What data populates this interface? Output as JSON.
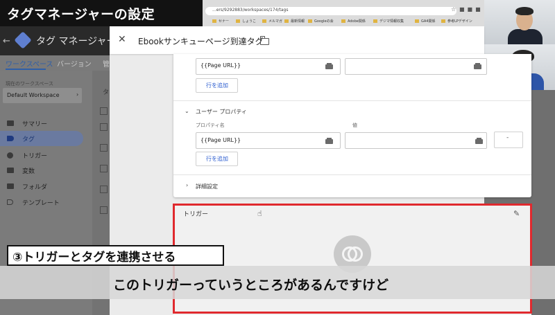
{
  "video_title": "タグマネージャーの設定",
  "browser": {
    "url": "...ers/9292883/workspaces/174/tags",
    "bookmarks": [
      "セナー",
      "しょうこ",
      "メルマガ",
      "最新情報",
      "Googleの会",
      "Adobe関係",
      "デジマ情報収集",
      "GA4関係",
      "参考LPデザイン"
    ]
  },
  "gtm": {
    "app_title": "タグ マネージャー",
    "tabs": [
      "ワークスペース",
      "バージョン",
      "管"
    ],
    "workspace_caption": "現在のワークスペース",
    "workspace_name": "Default Workspace",
    "nav": [
      {
        "label": "サマリー",
        "icon": "summary-icon"
      },
      {
        "label": "タグ",
        "icon": "tag-icon",
        "active": true
      },
      {
        "label": "トリガー",
        "icon": "trigger-icon"
      },
      {
        "label": "変数",
        "icon": "variables-icon"
      },
      {
        "label": "フォルダ",
        "icon": "folder-icon"
      },
      {
        "label": "テンプレート",
        "icon": "template-icon"
      }
    ],
    "list_header": "タ"
  },
  "editor": {
    "close_icon": "close-icon",
    "tag_name": "Ebookサンキューページ到達タグ",
    "top_field_value": "{{Page URL}}",
    "add_row_label": "行を追加",
    "user_properties": {
      "title": "ユーザー プロパティ",
      "name_col": "プロパティ名",
      "value_col": "値",
      "name_value": "{{Page URL}}",
      "value_value": "",
      "remove_label": "-"
    },
    "advanced_title": "詳細設定",
    "trigger": {
      "title": "トリガー",
      "edit_icon": "edit-pencil-icon"
    }
  },
  "overlays": {
    "step_label": "③トリガーとタグを連携させる",
    "caption": "このトリガーっていうところがあるんですけど"
  },
  "colors": {
    "highlight": "#e0292e",
    "link_blue": "#2f5fd0",
    "nav_active": "#2f5fa8"
  }
}
